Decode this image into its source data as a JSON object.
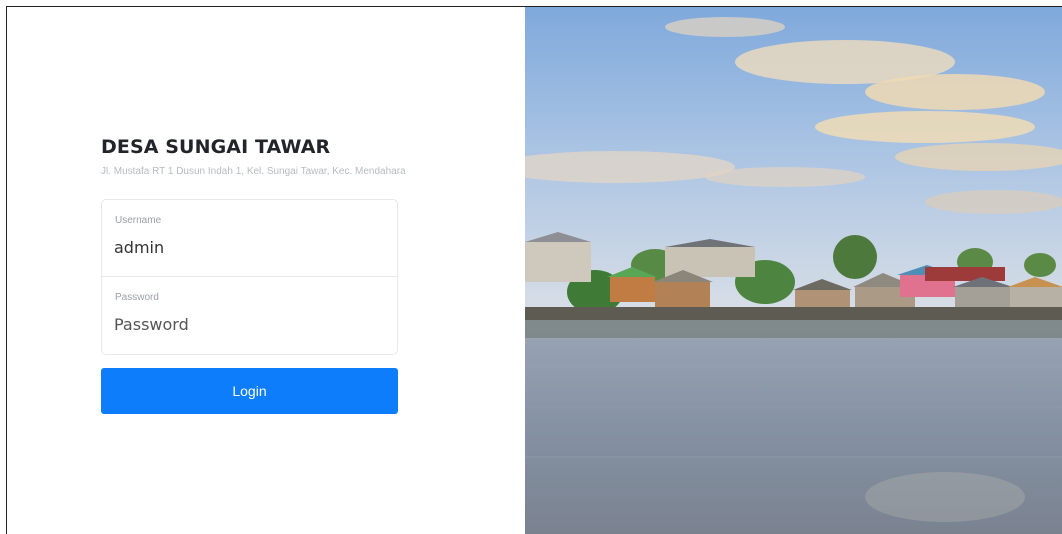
{
  "login": {
    "title": "DESA SUNGAI TAWAR",
    "address": "Jl. Mustafa RT 1 Dusun Indah 1, Kel. Sungai Tawar, Kec. Mendahara",
    "username_label": "Username",
    "username_value": "admin",
    "password_label": "Password",
    "password_placeholder": "Password",
    "login_button": "Login"
  },
  "colors": {
    "accent": "#0d7dfb"
  }
}
